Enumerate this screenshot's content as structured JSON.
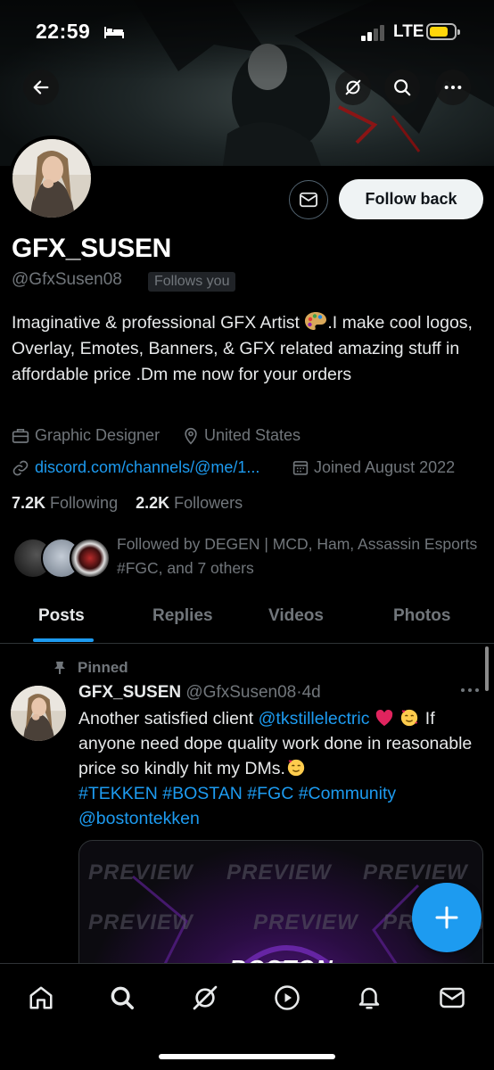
{
  "status_bar": {
    "time": "22:59",
    "network": "LTE",
    "battery_level": 0.75,
    "battery_color": "#ffd60a",
    "signal_bars_active": 2,
    "signal_bars_total": 4
  },
  "header": {
    "back_icon": "back-arrow-icon",
    "grok_icon": "grok-icon",
    "search_icon": "search-icon",
    "more_icon": "more-icon"
  },
  "profile": {
    "display_name": "GFX_SUSEN",
    "handle": "@GfxSusen08",
    "follows_you_badge": "Follows you",
    "follow_button": "Follow back",
    "bio_part1": "Imaginative & professional GFX Artist ",
    "bio_part2": ".I make cool logos, Overlay, Emotes, Banners, & GFX related amazing stuff in affordable price .Dm me now for your orders",
    "category": "Graphic Designer",
    "location": "United States",
    "website": "discord.com/channels/@me/1...",
    "joined": "Joined August 2022",
    "following_count": "7.2K",
    "following_label": "Following",
    "followers_count": "2.2K",
    "followers_label": "Followers",
    "followed_by": "Followed by DEGEN | MCD, Ham, Assassin Esports #FGC, and 7 others"
  },
  "tabs": [
    {
      "label": "Posts",
      "active": true
    },
    {
      "label": "Replies",
      "active": false
    },
    {
      "label": "Videos",
      "active": false
    },
    {
      "label": "Photos",
      "active": false
    }
  ],
  "post": {
    "pinned_label": "Pinned",
    "author_name": "GFX_SUSEN",
    "author_handle": "@GfxSusen08",
    "separator": "·",
    "time_ago": "4d",
    "text_1": "Another satisfied client ",
    "mention_1": "@tkstillelectric",
    "text_2": " If anyone need dope quality work done in reasonable price so kindly hit my DMs.",
    "hashtags": "#TEKKEN #BOSTAN #FGC #Community",
    "mention_2": "@bostontekken",
    "media_watermark": "PREVIEW",
    "media_text": "BOSTON"
  },
  "bottom_nav": [
    {
      "icon": "home-icon"
    },
    {
      "icon": "search-icon"
    },
    {
      "icon": "grok-icon"
    },
    {
      "icon": "play-icon"
    },
    {
      "icon": "bell-icon"
    },
    {
      "icon": "mail-icon"
    }
  ],
  "colors": {
    "accent": "#1d9bf0",
    "muted": "#71767b",
    "text": "#e7e9ea",
    "background": "#000000"
  }
}
